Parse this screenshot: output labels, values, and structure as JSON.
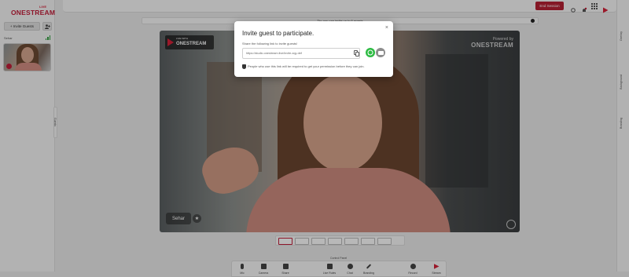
{
  "brand": {
    "logo_small": "LIVE",
    "logo_main": "ONESTREAM"
  },
  "left_panel": {
    "invite_button": "+ Invite Guests",
    "guest_name": "Sehar",
    "tab_label": "Guests"
  },
  "topbar": {
    "end_session": "End Session"
  },
  "message_bar": {
    "text": "Tip: you can invite up to 6 guests"
  },
  "stage": {
    "logo_small": "LIVE WITH",
    "logo_main": "ONESTREAM",
    "powered_by": "Powered by",
    "powered_main": "ONESTREAM",
    "name_tag": "Sehar"
  },
  "right_panel": {
    "tabs": [
      "Overlay",
      "Background",
      "Branding"
    ]
  },
  "control_panel_label": "Control Panel",
  "controls": [
    {
      "label": "Mic",
      "icon": "mic-icon"
    },
    {
      "label": "Camera",
      "icon": "camera-icon"
    },
    {
      "label": "Share",
      "icon": "share-icon"
    },
    {
      "label": "Live Rules",
      "icon": "tag-icon"
    },
    {
      "label": "Chat",
      "icon": "chat-icon"
    },
    {
      "label": "Branding",
      "icon": "brush-icon"
    },
    {
      "label": "Record",
      "icon": "record-icon"
    },
    {
      "label": "Stream",
      "icon": "stream-icon"
    }
  ],
  "modal": {
    "title": "Invite guest to participate.",
    "subtitle": "Share the following link to invite guests!",
    "link": "https://studio.onestream.live/invite-xqy-def",
    "note": "People who use this link will be required to get your permission before they can join."
  },
  "colors": {
    "brand_red": "#c41e3a",
    "whatsapp_green": "#2dbb43",
    "end_session": "#b82034"
  }
}
